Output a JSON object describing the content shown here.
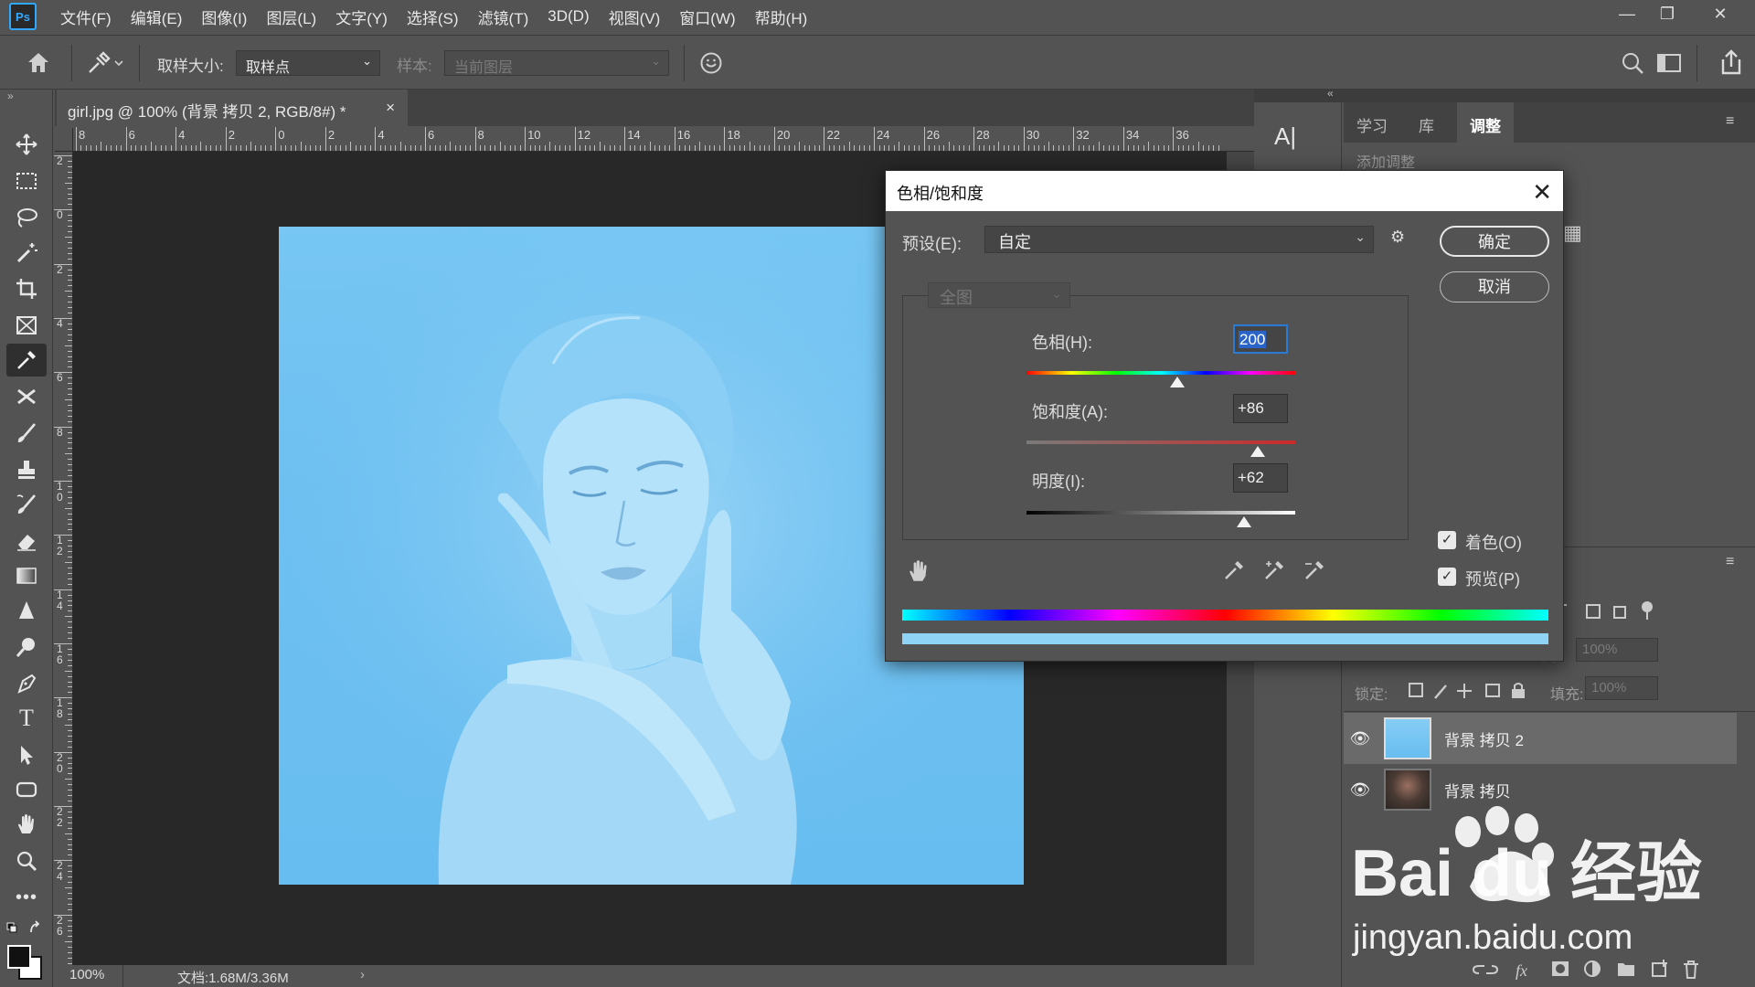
{
  "app": {
    "logo": "Ps"
  },
  "menu": [
    "文件(F)",
    "编辑(E)",
    "图像(I)",
    "图层(L)",
    "文字(Y)",
    "选择(S)",
    "滤镜(T)",
    "3D(D)",
    "视图(V)",
    "窗口(W)",
    "帮助(H)"
  ],
  "window_controls": {
    "minimize": "—",
    "restore": "❐",
    "close": "✕"
  },
  "options": {
    "sample_size_label": "取样大小:",
    "sample_size_value": "取样点",
    "sample_label": "样本:",
    "sample_value": "当前图层"
  },
  "document": {
    "tab_title": "girl.jpg @ 100% (背景 拷贝 2, RGB/8#) *",
    "close": "×",
    "zoom": "100%",
    "doc_info": "文档:1.68M/3.36M",
    "hruler_ticks": [
      "8",
      "6",
      "4",
      "2",
      "0",
      "2",
      "4",
      "6",
      "8",
      "10",
      "12",
      "14",
      "16",
      "18",
      "20",
      "22",
      "24",
      "26",
      "28",
      "30",
      "32",
      "34",
      "36"
    ],
    "vruler_ticks": [
      "2",
      "0",
      "2",
      "4",
      "6",
      "8",
      "10",
      "12",
      "14",
      "16",
      "18",
      "20",
      "22",
      "24",
      "26"
    ]
  },
  "right_panel": {
    "tabs": [
      "学习",
      "库",
      "调整"
    ],
    "add_adjustment": "添加调整",
    "opacity_label": "度:",
    "opacity_value": "100%",
    "lock_label": "锁定:",
    "fill_label": "填充:",
    "fill_value": "100%",
    "layers": [
      {
        "name": "背景 拷贝 2",
        "selected": true
      },
      {
        "name": "背景 拷贝",
        "selected": false
      }
    ]
  },
  "dialog": {
    "title": "色相/饱和度",
    "close": "✕",
    "preset_label": "预设(E):",
    "preset_value": "自定",
    "ok": "确定",
    "cancel": "取消",
    "channel": "全图",
    "hue_label": "色相(H):",
    "hue_value": "200",
    "hue_slider": 0.56,
    "saturation_label": "饱和度(A):",
    "saturation_value": "+86",
    "saturation_slider": 0.86,
    "lightness_label": "明度(I):",
    "lightness_value": "+62",
    "lightness_slider": 0.81,
    "colorize_label": "着色(O)",
    "colorize_checked": true,
    "preview_label": "预览(P)",
    "preview_checked": true,
    "colorize_bar_color": "#8fd3f6"
  },
  "watermark": {
    "brand": "Bai du 经验",
    "url": "jingyan.baidu.com"
  }
}
